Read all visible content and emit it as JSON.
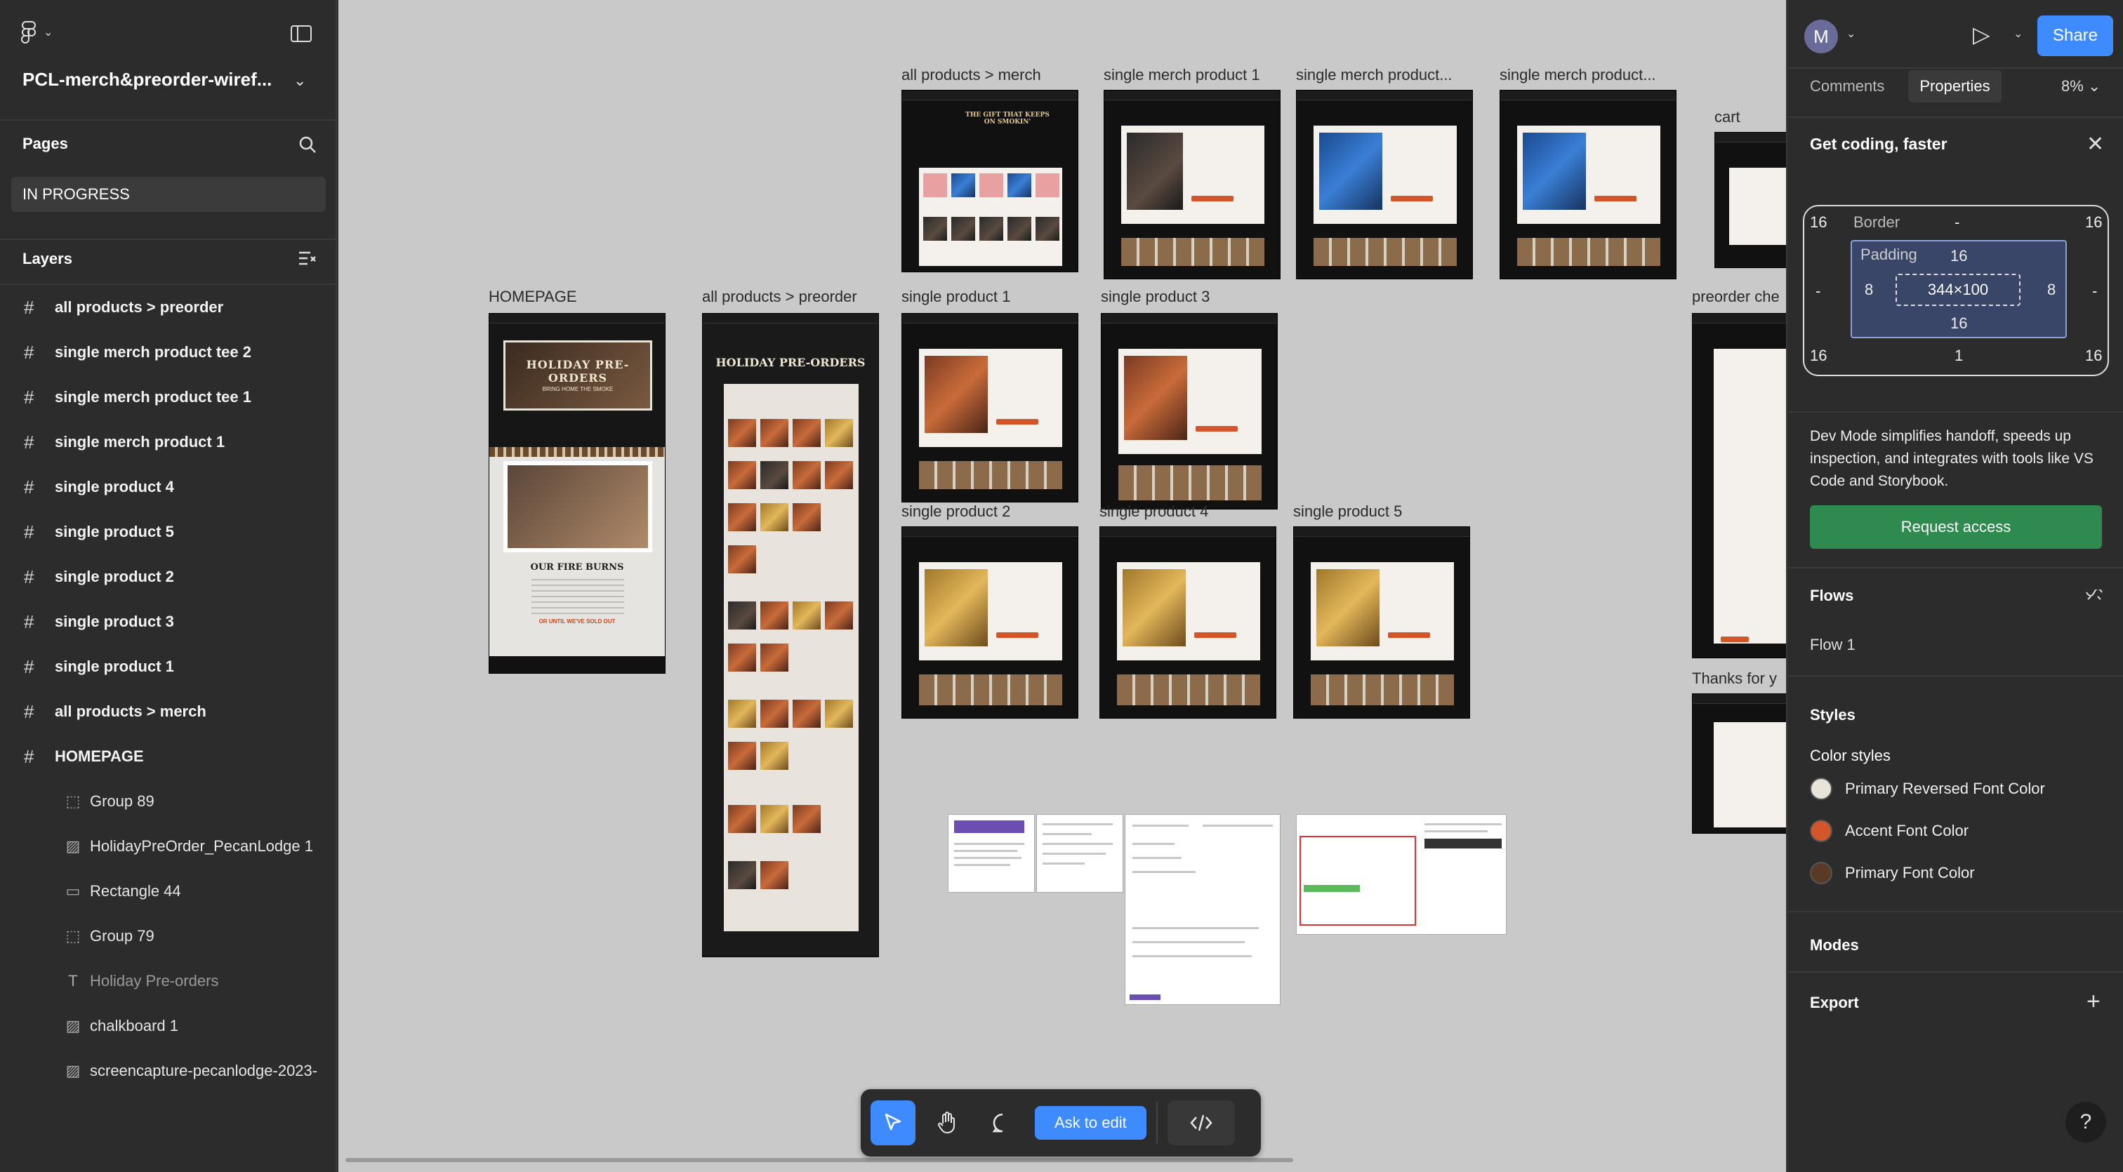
{
  "file": {
    "name": "PCL-merch&preorder-wiref..."
  },
  "sidebar": {
    "pages_title": "Pages",
    "current_page": "IN PROGRESS",
    "layers_title": "Layers",
    "layers": [
      "all products > preorder",
      "single merch product tee 2",
      "single merch product tee 1",
      "single merch product 1",
      "single product 4",
      "single product 5",
      "single product 2",
      "single product 3",
      "single product 1",
      "all products > merch",
      "HOMEPAGE"
    ],
    "sublayers": [
      {
        "label": "Group 89",
        "icon": "group-icon"
      },
      {
        "label": "HolidayPreOrder_PecanLodge 1",
        "icon": "image-icon"
      },
      {
        "label": "Rectangle 44",
        "icon": "rectangle-icon"
      },
      {
        "label": "Group 79",
        "icon": "group-icon"
      },
      {
        "label": "Holiday Pre-orders",
        "icon": "text-icon"
      },
      {
        "label": "chalkboard 1",
        "icon": "image-icon"
      },
      {
        "label": "screencapture-pecanlodge-2023-",
        "icon": "image-icon"
      }
    ]
  },
  "canvas": {
    "frames": [
      "HOMEPAGE",
      "all products > preorder",
      "all products > merch",
      "single merch product 1",
      "single merch product...",
      "single merch product...",
      "cart",
      "single product 1",
      "single product 3",
      "single product 2",
      "single product 4",
      "single product 5",
      "preorder che",
      "Thanks for y"
    ],
    "homepage_text": {
      "hero": "HOLIDAY PRE-ORDERS",
      "hero_sub": "BRING HOME THE SMOKE",
      "fire": "OUR FIRE BURNS",
      "sold": "OR UNTIL WE'VE SOLD OUT"
    },
    "preorder_hero": "HOLIDAY PRE-ORDERS",
    "merch_hero": "THE GIFT THAT KEEPS ON SMOKIN'"
  },
  "toolbar": {
    "ask_label": "Ask to edit"
  },
  "right_panel": {
    "avatar_initial": "M",
    "share_label": "Share",
    "tabs": [
      "Comments",
      "Properties"
    ],
    "zoom": "8%",
    "banner_title": "Get coding, faster",
    "box": {
      "border_label": "Border",
      "border_dash": "-",
      "padding_label": "Padding",
      "corner_tl": "16",
      "corner_tr": "16",
      "corner_bl": "16",
      "corner_br": "16",
      "border_left": "-",
      "border_right": "-",
      "border_bottom": "1",
      "pad_top": "16",
      "pad_bottom": "16",
      "pad_left": "8",
      "pad_right": "8",
      "size": "344×100"
    },
    "dev_text": "Dev Mode simplifies handoff, speeds up inspection, and integrates with tools like VS Code and Storybook.",
    "request_label": "Request access",
    "flows_title": "Flows",
    "flow_item": "Flow 1",
    "styles_title": "Styles",
    "color_styles_title": "Color styles",
    "colors": [
      {
        "name": "Primary Reversed Font Color",
        "hex": "#e9e4da"
      },
      {
        "name": "Accent Font Color",
        "hex": "#d2562a"
      },
      {
        "name": "Primary Font Color",
        "hex": "#5a3a26"
      }
    ],
    "modes_title": "Modes",
    "export_title": "Export",
    "help": "?"
  }
}
